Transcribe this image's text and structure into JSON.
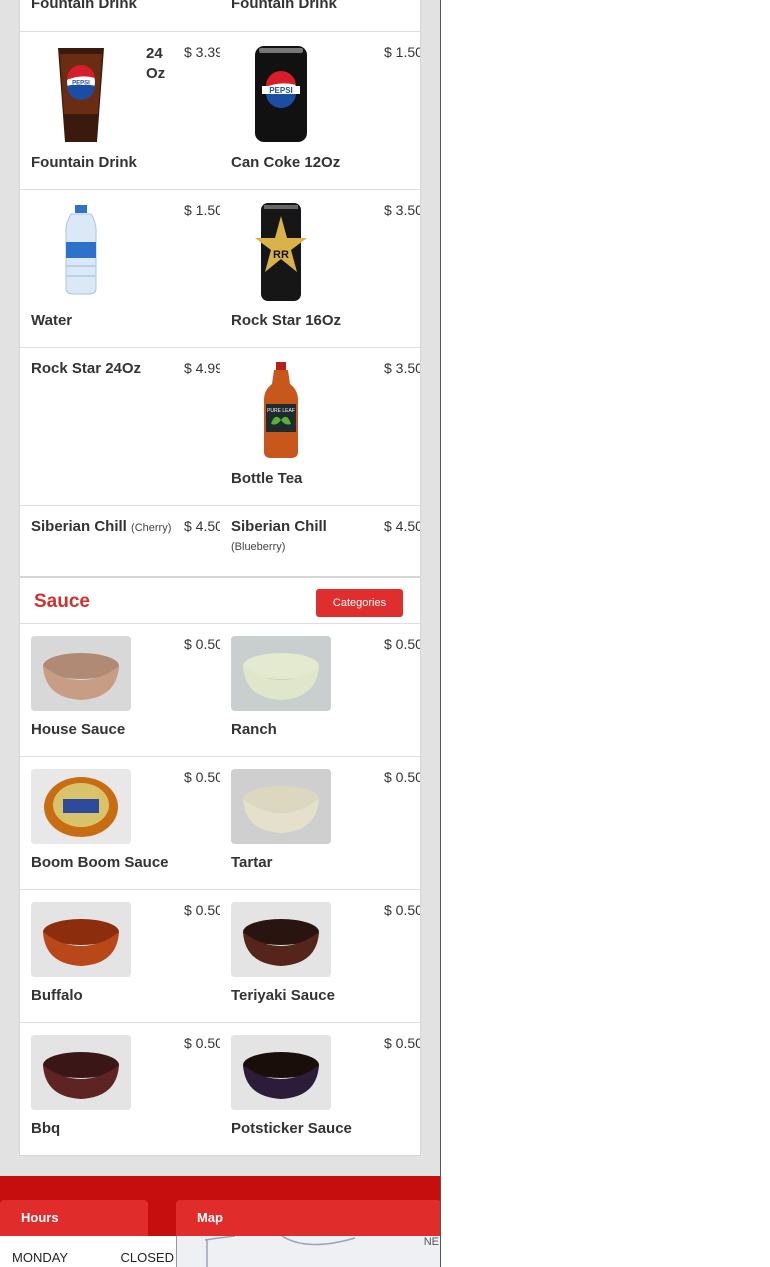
{
  "drinks": {
    "top_partial": {
      "left": "Fountain Drink",
      "right": "Fountain Drink"
    },
    "rows": [
      {
        "left": {
          "name": "Fountain Drink",
          "size": "24 Oz",
          "price": "$ 3.39",
          "icon": "pepsi-cup"
        },
        "right": {
          "name": "Can Coke 12Oz",
          "price": "$ 1.50",
          "icon": "pepsi-can"
        }
      },
      {
        "left": {
          "name": "Water",
          "price": "$ 1.50",
          "icon": "water-bottle"
        },
        "right": {
          "name": "Rock Star 16Oz",
          "price": "$ 3.50",
          "icon": "rockstar-can"
        }
      },
      {
        "left": {
          "name": "Rock Star 24Oz",
          "price": "$ 4.99"
        },
        "right": {
          "name": "Bottle Tea",
          "price": "$ 3.50",
          "icon": "tea-bottle"
        }
      },
      {
        "left": {
          "name": "Siberian Chill",
          "note": "(Cherry)",
          "price": "$ 4.50"
        },
        "right": {
          "name": "Siberian Chill",
          "note": "(Blueberry)",
          "price": "$ 4.50"
        }
      }
    ]
  },
  "sauce": {
    "title": "Sauce",
    "categories_label": "Categories",
    "rows": [
      {
        "left": {
          "name": "House Sauce",
          "price": "$ 0.50"
        },
        "right": {
          "name": "Ranch",
          "price": "$ 0.50"
        }
      },
      {
        "left": {
          "name": "Boom Boom Sauce",
          "price": "$ 0.50"
        },
        "right": {
          "name": "Tartar",
          "price": "$ 0.50"
        }
      },
      {
        "left": {
          "name": "Buffalo",
          "price": "$ 0.50"
        },
        "right": {
          "name": "Teriyaki Sauce",
          "price": "$ 0.50"
        }
      },
      {
        "left": {
          "name": "Bbq",
          "price": "$ 0.50"
        },
        "right": {
          "name": "Potsticker Sauce",
          "price": "$ 0.50"
        }
      }
    ]
  },
  "footer": {
    "hours_label": "Hours",
    "map_label": "Map",
    "hours": [
      {
        "day": "MONDAY",
        "status": "CLOSED"
      }
    ],
    "map_text": "NE"
  },
  "colors": {
    "accent": "#e02e2e",
    "footer_bg": "#c70e0e",
    "title_red": "#d32f2f"
  }
}
